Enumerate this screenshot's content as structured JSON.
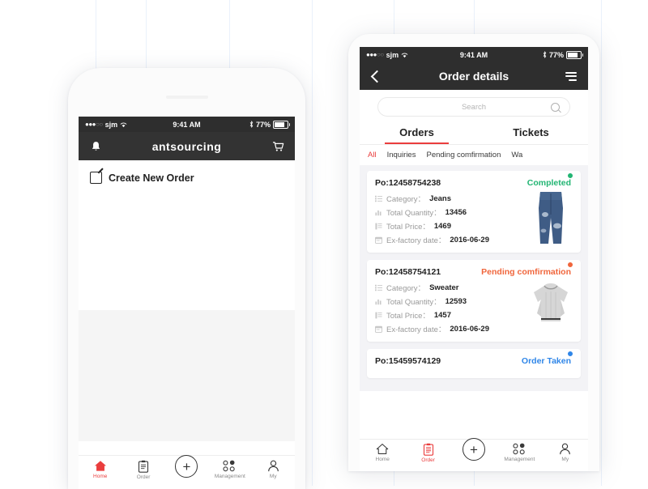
{
  "canvas": {
    "background": "#ffffff"
  },
  "colors": {
    "accent_red": "#ea3d3d",
    "status_completed": "#22b573",
    "status_pending": "#f0663c",
    "status_taken": "#2f86e8",
    "bar_dark": "#2e2e2e",
    "list_bg": "#f3f3f6"
  },
  "left_phone": {
    "status_bar": {
      "carrier": "sjm",
      "time": "9:41 AM",
      "battery_percent": "77%",
      "signal_dots_filled": 3,
      "signal_dots_total": 5,
      "wifi_icon": "wifi-icon",
      "bluetooth_icon": "bluetooth-icon",
      "battery_icon": "battery-icon"
    },
    "app_bar": {
      "left_icon": "bell-icon",
      "brand": "antsourcing",
      "right_icon": "cart-icon"
    },
    "create_order": {
      "icon": "compose-icon",
      "label": "Create New Order"
    },
    "tabbar": [
      {
        "label": "Home",
        "icon": "home-icon",
        "active": true
      },
      {
        "label": "Order",
        "icon": "clipboard-icon",
        "active": false
      },
      {
        "label": "",
        "icon": "plus-icon",
        "active": false
      },
      {
        "label": "Management",
        "icon": "grid-icon",
        "active": false
      },
      {
        "label": "My",
        "icon": "person-icon",
        "active": false
      }
    ]
  },
  "right_phone": {
    "status_bar": {
      "carrier": "sjm",
      "time": "9:41 AM",
      "battery_percent": "77%",
      "signal_dots_filled": 3,
      "signal_dots_total": 5,
      "wifi_icon": "wifi-icon",
      "bluetooth_icon": "bluetooth-icon",
      "battery_icon": "battery-icon"
    },
    "app_bar": {
      "back_icon": "chevron-left-icon",
      "title": "Order details",
      "menu_icon": "hamburger-icon"
    },
    "search": {
      "placeholder": "Search",
      "value": "",
      "icon": "search-icon"
    },
    "main_tabs": [
      {
        "label": "Orders",
        "active": true
      },
      {
        "label": "Tickets",
        "active": false
      }
    ],
    "filters": [
      {
        "label": "All",
        "active": true
      },
      {
        "label": "Inquiries",
        "active": false
      },
      {
        "label": "Pending comfirmation",
        "active": false
      },
      {
        "label": "Wa",
        "active": false
      }
    ],
    "field_labels": {
      "category": "Category：",
      "quantity": "Total Quantity：",
      "price": "Total Price：",
      "date": "Ex-factory date："
    },
    "orders": [
      {
        "po": "Po:12458754238",
        "status": "Completed",
        "status_color": "#22b573",
        "category": "Jeans",
        "quantity": "13456",
        "price": "1469",
        "date": "2016-06-29",
        "thumb": "jeans-thumbnail"
      },
      {
        "po": "Po:12458754121",
        "status": "Pending comfirmation",
        "status_color": "#f0663c",
        "category": "Sweater",
        "quantity": "12593",
        "price": "1457",
        "date": "2016-06-29",
        "thumb": "sweater-thumbnail"
      },
      {
        "po": "Po:15459574129",
        "status": "Order Taken",
        "status_color": "#2f86e8",
        "category": "",
        "quantity": "",
        "price": "",
        "date": "",
        "thumb": ""
      }
    ],
    "tabbar": [
      {
        "label": "Home",
        "icon": "home-icon",
        "active": false
      },
      {
        "label": "Order",
        "icon": "clipboard-icon",
        "active": true
      },
      {
        "label": "",
        "icon": "plus-icon",
        "active": false
      },
      {
        "label": "Management",
        "icon": "grid-icon",
        "active": false
      },
      {
        "label": "My",
        "icon": "person-icon",
        "active": false
      }
    ]
  }
}
